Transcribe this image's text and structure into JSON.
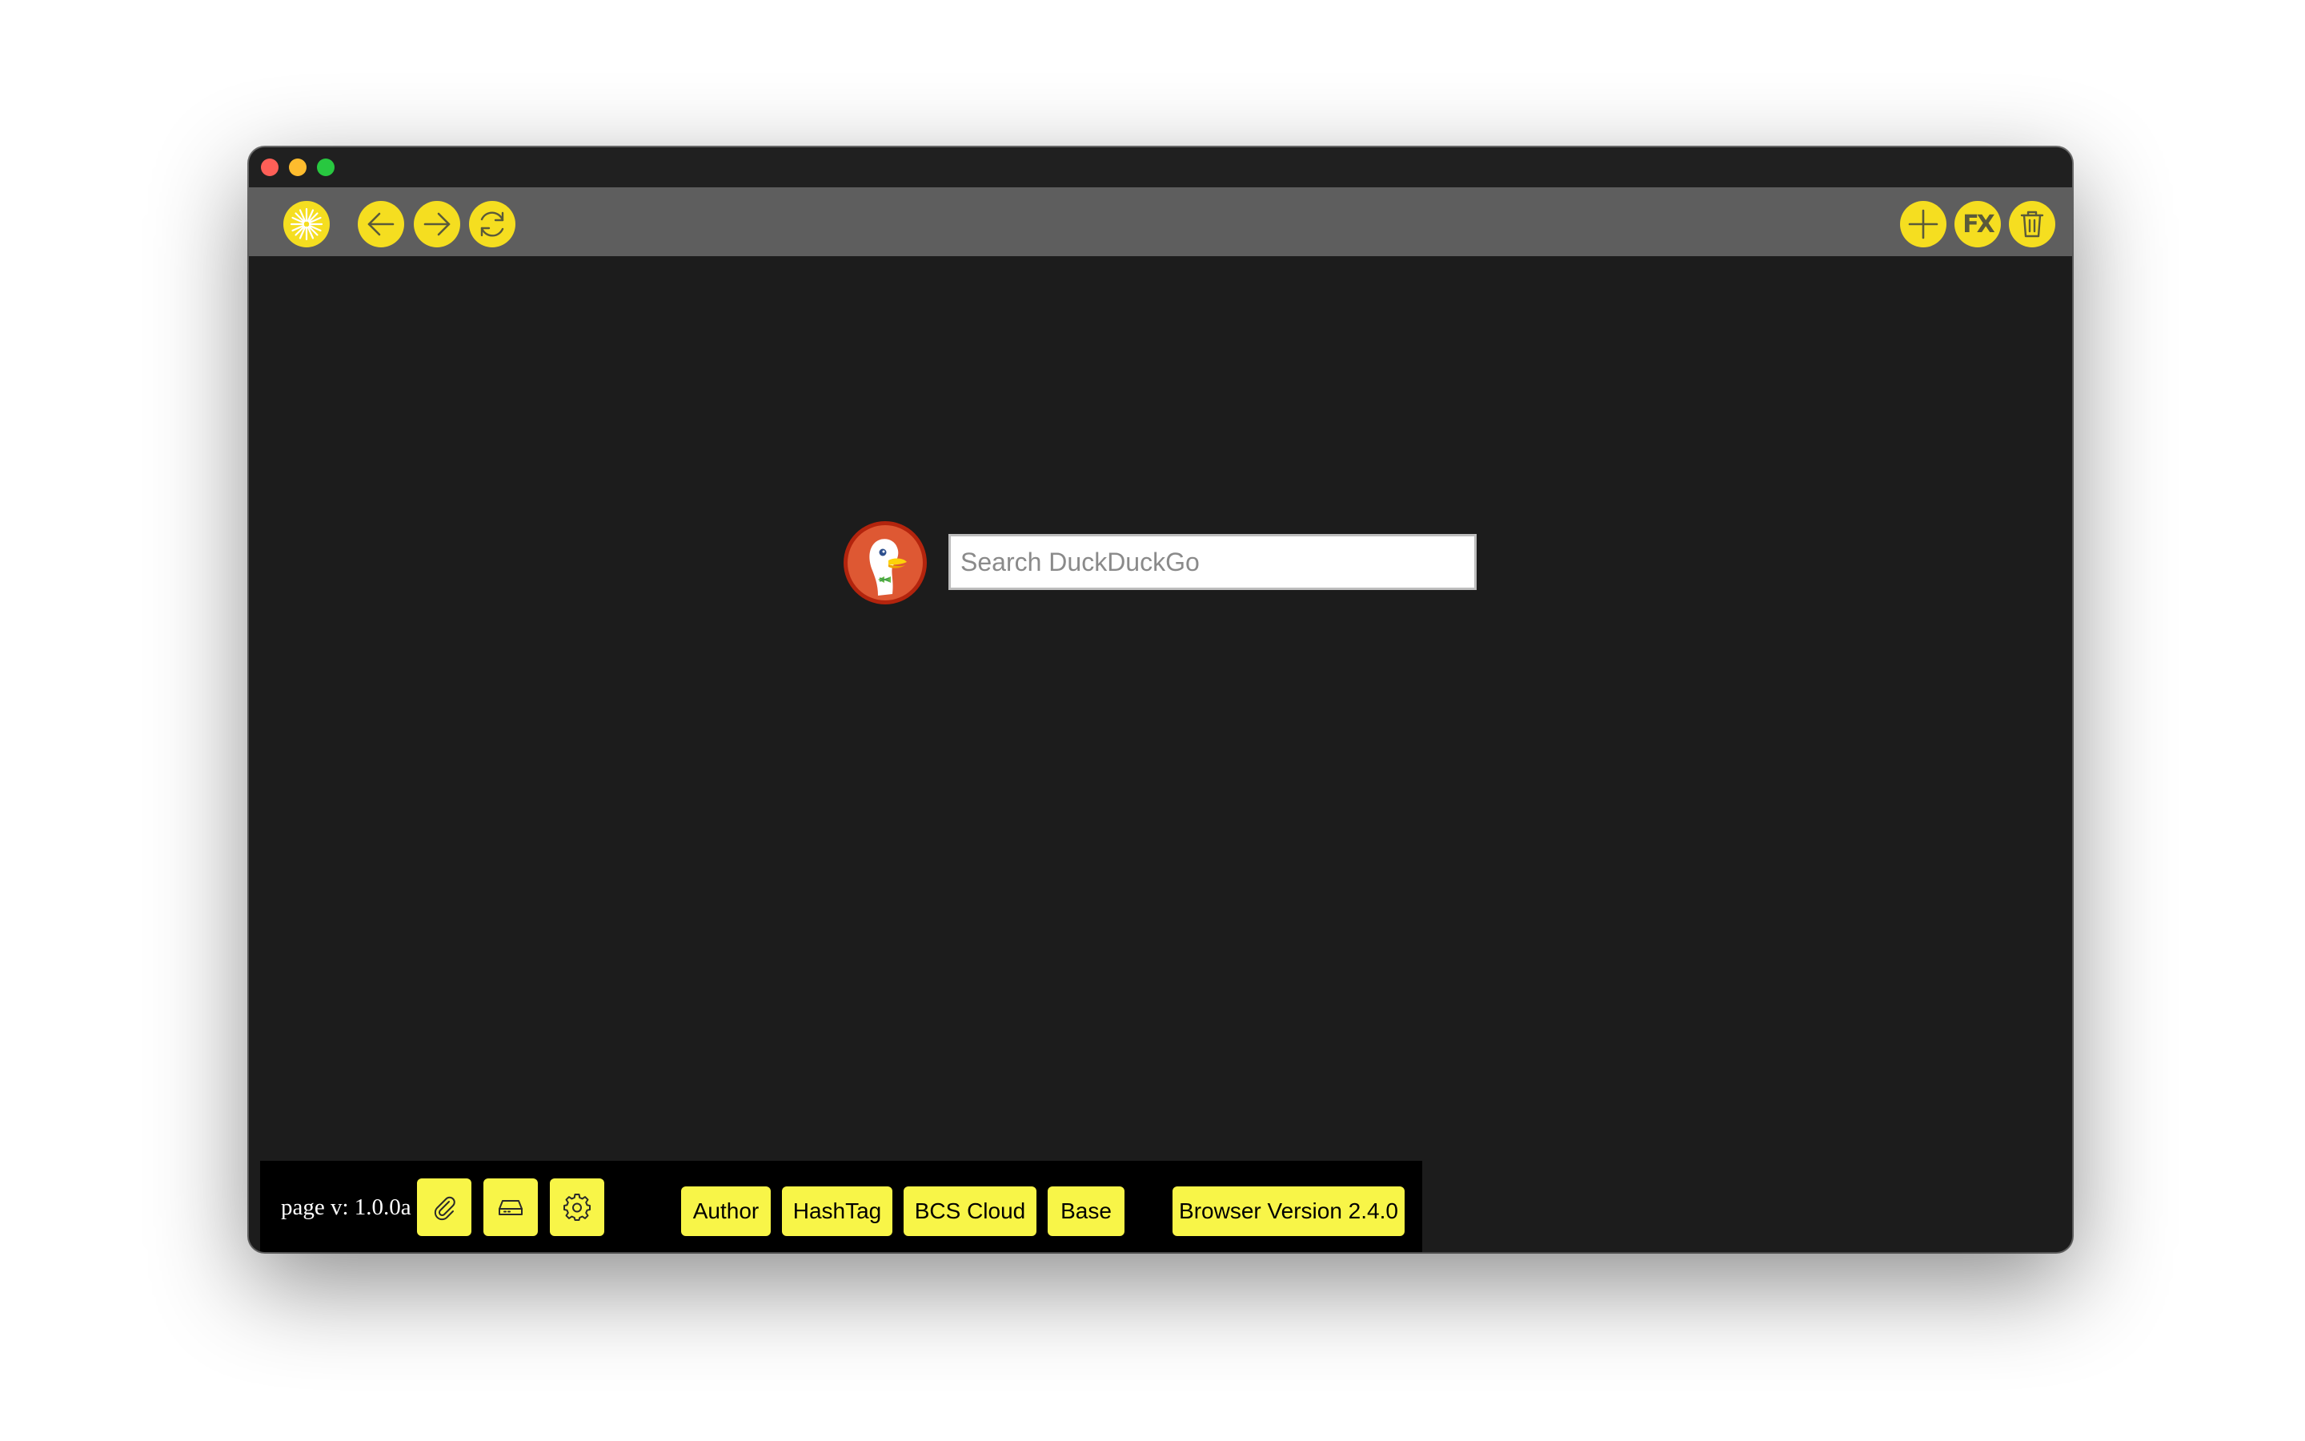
{
  "window": {
    "traffic_lights": [
      "close",
      "minimize",
      "zoom"
    ]
  },
  "toolbar": {
    "left_buttons": [
      {
        "name": "home-logo-icon"
      },
      {
        "name": "back-arrow-icon"
      },
      {
        "name": "forward-arrow-icon"
      },
      {
        "name": "reload-icon"
      }
    ],
    "right_buttons": [
      {
        "name": "plus-icon"
      },
      {
        "name": "fx-icon",
        "label": "FX"
      },
      {
        "name": "trash-icon"
      }
    ],
    "accent_color": "#f5de20"
  },
  "search": {
    "placeholder": "Search DuckDuckGo",
    "value": "",
    "logo": "duckduckgo-logo-icon"
  },
  "bottombar": {
    "page_version": "page v: 1.0.0a",
    "icon_buttons": [
      "paperclip-icon",
      "drive-icon",
      "gear-icon"
    ],
    "links": {
      "author": "Author",
      "hashtag": "HashTag",
      "bcs_cloud": "BCS Cloud",
      "base": "Base",
      "browser_version": "Browser Version 2.4.0"
    },
    "button_color": "#f8f548"
  }
}
